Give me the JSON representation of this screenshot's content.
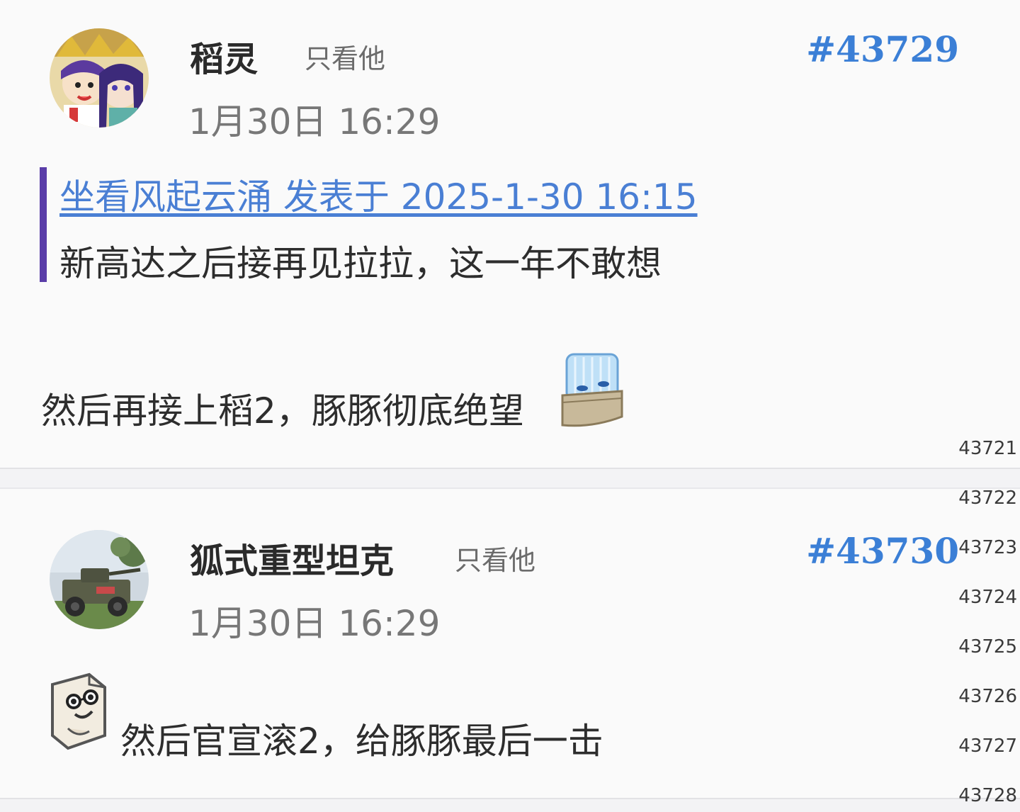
{
  "posts": [
    {
      "username": "稻灵",
      "only_him": "只看他",
      "time": "1月30日 16:29",
      "floor": "#43729",
      "quote": {
        "link": "坐看风起云涌 发表于 2025-1-30 16:15",
        "text": "新高达之后接再见拉拉，这一年不敢想"
      },
      "body": "然后再接上稻2，豚豚彻底绝望",
      "avatar_icon": "anime-characters-avatar",
      "emoji_icon": "crying-block-sticker"
    },
    {
      "username": "狐式重型坦克",
      "only_him": "只看他",
      "time": "1月30日 16:29",
      "floor": "#43730",
      "body": "然后官宣滚2，给豚豚最后一击",
      "avatar_icon": "armored-car-avatar",
      "emoji_icon": "smug-glasses-sticker"
    }
  ],
  "floor_index": [
    "43721",
    "43722",
    "43723",
    "43724",
    "43725",
    "43726",
    "43727",
    "43728"
  ],
  "colors": {
    "accent_blue": "#3b7fd6",
    "quote_bar": "#5a3da8",
    "background": "#fafafa"
  }
}
